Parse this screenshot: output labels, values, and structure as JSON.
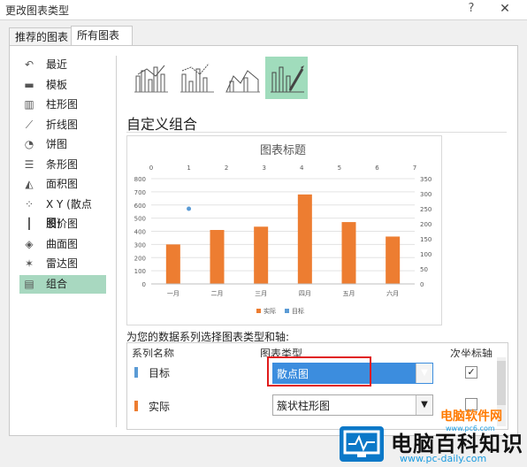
{
  "window": {
    "title": "更改图表类型",
    "help": "?",
    "close": "✕"
  },
  "tabs": [
    {
      "label": "推荐的图表"
    },
    {
      "label": "所有图表"
    }
  ],
  "sidebar": {
    "items": [
      {
        "label": "最近",
        "icon": "recent-icon"
      },
      {
        "label": "模板",
        "icon": "folder-icon"
      },
      {
        "label": "柱形图",
        "icon": "column-chart-icon"
      },
      {
        "label": "折线图",
        "icon": "line-chart-icon"
      },
      {
        "label": "饼图",
        "icon": "pie-chart-icon"
      },
      {
        "label": "条形图",
        "icon": "bar-chart-icon"
      },
      {
        "label": "面积图",
        "icon": "area-chart-icon"
      },
      {
        "label": "X Y (散点图)",
        "icon": "scatter-chart-icon"
      },
      {
        "label": "股价图",
        "icon": "stock-chart-icon"
      },
      {
        "label": "曲面图",
        "icon": "surface-chart-icon"
      },
      {
        "label": "雷达图",
        "icon": "radar-chart-icon"
      },
      {
        "label": "组合",
        "icon": "combo-chart-icon",
        "selected": true
      }
    ]
  },
  "combo": {
    "title": "自定义组合",
    "prompt": "为您的数据系列选择图表类型和轴:",
    "columns": {
      "series": "系列名称",
      "type": "图表类型",
      "secondary": "次坐标轴"
    },
    "rows": [
      {
        "name": "目标",
        "type": "散点图",
        "color": "#5b9bd5",
        "secondary": true,
        "highlighted": true
      },
      {
        "name": "实际",
        "type": "簇状柱形图",
        "color": "#ed7d31",
        "secondary": false,
        "highlighted": false
      }
    ]
  },
  "chart_data": {
    "type": "bar",
    "title": "图表标题",
    "categories": [
      "一月",
      "二月",
      "三月",
      "四月",
      "五月",
      "六月"
    ],
    "series": [
      {
        "name": "实际",
        "values": [
          300,
          410,
          435,
          680,
          470,
          360
        ],
        "color": "#ed7d31"
      },
      {
        "name": "目标",
        "x": [
          1
        ],
        "y": [
          250
        ],
        "color": "#5b9bd5",
        "axis": "secondary"
      }
    ],
    "y_ticks": [
      "0",
      "100",
      "200",
      "300",
      "400",
      "500",
      "600",
      "700",
      "800"
    ],
    "ylim": [
      0,
      800
    ],
    "y2_ticks": [
      "0",
      "50",
      "100",
      "150",
      "200",
      "250",
      "300",
      "350"
    ],
    "y2lim": [
      0,
      350
    ],
    "x2_ticks": [
      "0",
      "1",
      "2",
      "3",
      "4",
      "5",
      "6",
      "7"
    ],
    "x2lim": [
      0,
      7
    ],
    "legend_position": "bottom",
    "legend": [
      {
        "name": "实际",
        "color": "#ed7d31"
      },
      {
        "name": "目标",
        "color": "#5b9bd5"
      }
    ]
  },
  "watermark": {
    "site_cn": "电脑软件网",
    "site_url_small": "www.pc6.com",
    "brand": "电脑百科知识",
    "brand_url": "www.pc-daily.com"
  }
}
